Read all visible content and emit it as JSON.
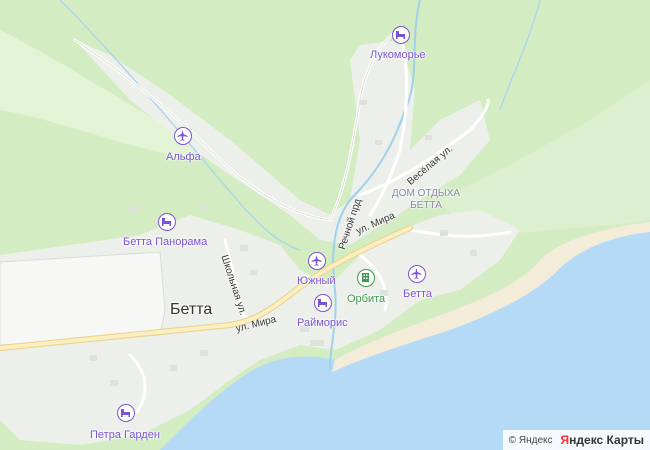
{
  "map": {
    "town_label": "Бетта",
    "area_label_line1": "ДОМ ОТДЫХА",
    "area_label_line2": "БЕТТА",
    "pois": {
      "lukomorye": "Лукоморье",
      "alfa": "Альфа",
      "betta_panorama": "Бетта Панорама",
      "yuzhny": "Южный",
      "raimoris": "Райморис",
      "orbita": "Орбита",
      "betta_resort": "Бетта",
      "petra_garden": "Петра Гарден"
    },
    "streets": {
      "mira_east": "ул. Мира",
      "mira_west": "ул. Мира",
      "shkolnaya": "Школьная ул.",
      "rechnoy": "Речной прд",
      "vesyolaya": "Весёлая ул."
    }
  },
  "attribution": {
    "copyright": "© Яндекс",
    "brand_ya": "Я",
    "brand_rest": "ндекс Карты"
  },
  "colors": {
    "forest": "#cfe9bd",
    "settlement": "#eef0ec",
    "sea": "#b5dcf7",
    "road": "#f5e3a3",
    "poi": "#7a54d6",
    "poi_green": "#3d9a4f"
  }
}
